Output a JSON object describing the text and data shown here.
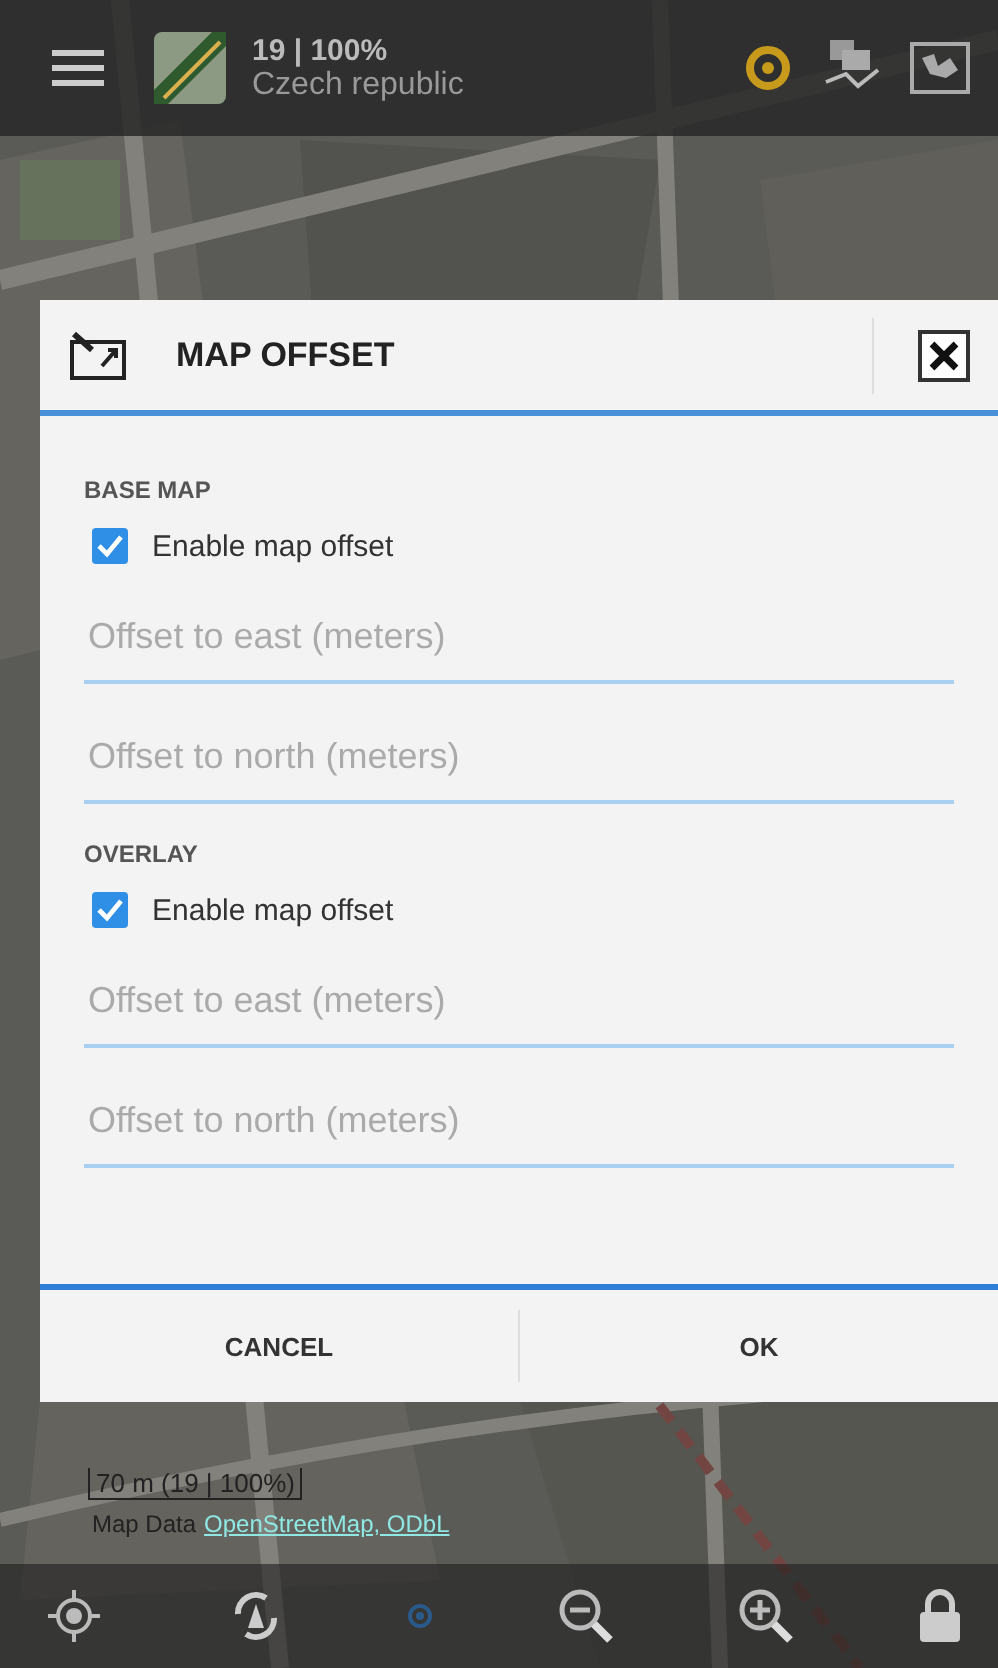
{
  "top_bar": {
    "zoom_info": "19 | 100%",
    "map_name": "Czech republic"
  },
  "dialog": {
    "title": "MAP OFFSET",
    "sections": [
      {
        "heading": "BASE MAP",
        "checkbox": {
          "label": "Enable map offset",
          "checked": true
        },
        "fields": [
          {
            "placeholder": "Offset to east (meters)"
          },
          {
            "placeholder": "Offset to north (meters)"
          }
        ]
      },
      {
        "heading": "OVERLAY",
        "checkbox": {
          "label": "Enable map offset",
          "checked": true
        },
        "fields": [
          {
            "placeholder": "Offset to east (meters)"
          },
          {
            "placeholder": "Offset to north (meters)"
          }
        ]
      }
    ],
    "buttons": [
      "CANCEL",
      "OK"
    ]
  },
  "map_overlay": {
    "scale": "70 m (19 | 100%)",
    "attribution_prefix": "Map Data",
    "attribution_link": "OpenStreetMap, ODbL"
  }
}
